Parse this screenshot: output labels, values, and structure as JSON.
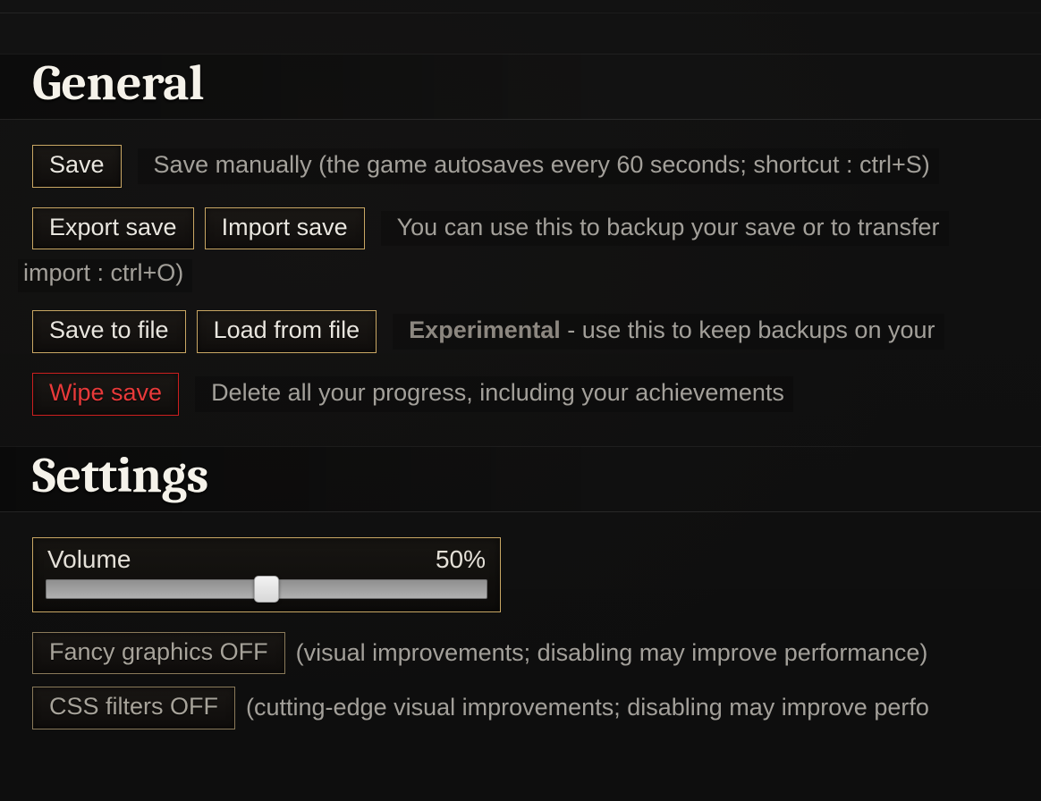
{
  "general": {
    "heading": "General",
    "save": {
      "button": "Save",
      "desc": "Save manually (the game autosaves every 60 seconds; shortcut : ctrl+S)"
    },
    "export_import": {
      "export_button": "Export save",
      "import_button": "Import save",
      "desc_line1": "You can use this to backup your save or to transfer",
      "desc_line2": "import : ctrl+O)"
    },
    "file": {
      "save_button": "Save to file",
      "load_button": "Load from file",
      "desc_strong": "Experimental",
      "desc_rest": " - use this to keep backups on your"
    },
    "wipe": {
      "button": "Wipe save",
      "desc": "Delete all your progress, including your achievements"
    }
  },
  "settings": {
    "heading": "Settings",
    "volume": {
      "label": "Volume",
      "value_text": "50%",
      "value_percent": 50
    },
    "fancy_graphics": {
      "button": "Fancy graphics OFF",
      "desc": "(visual improvements; disabling may improve performance)"
    },
    "css_filters": {
      "button": "CSS filters OFF",
      "desc": "(cutting-edge visual improvements; disabling may improve perfo"
    }
  }
}
